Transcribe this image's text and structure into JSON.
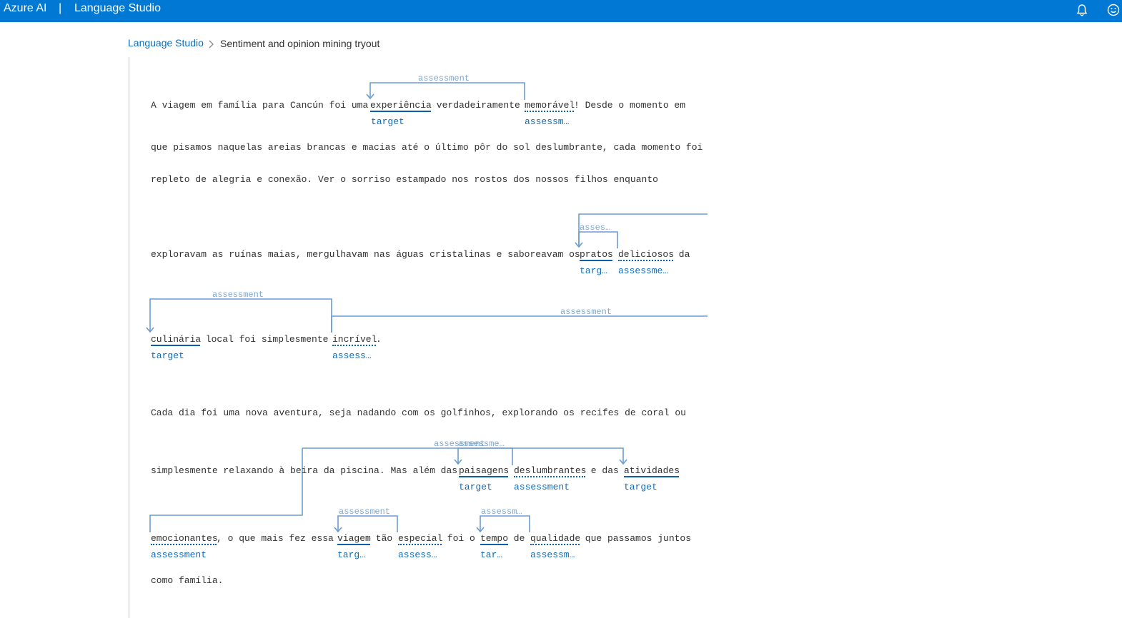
{
  "header": {
    "brand": "Azure AI",
    "separator": "|",
    "product": "Language Studio"
  },
  "breadcrumb": {
    "home": "Language Studio",
    "current": "Sentiment and opinion mining tryout"
  },
  "labels": {
    "target": "target",
    "assessment": "assessment",
    "targ_trunc": "targ…",
    "tar_trunc": "tar…",
    "assess_trunc": "assess…",
    "assessm_trunc": "assessm…",
    "assessme_trunc": "assessme…",
    "asses_trunc": "asses…",
    "assessme_trunc_over": "assessme…",
    "assessm_over": "assessm…"
  },
  "document": {
    "line1": {
      "a": "A viagem em família para Cancún foi uma ",
      "w1": "experiência",
      "b": " verdadeiramente ",
      "w2": "memorável",
      "c": "! Desde o momento em"
    },
    "line2": "que pisamos naquelas areias brancas e macias até o último pôr do sol deslumbrante, cada momento foi",
    "line3": "repleto de alegria e conexão. Ver o sorriso estampado nos rostos dos nossos filhos enquanto",
    "line4": {
      "a": "exploravam as ruínas maias, mergulhavam nas águas cristalinas e saboreavam os ",
      "w1": "pratos",
      "b": " ",
      "w2": "deliciosos",
      "c": " da"
    },
    "line5": {
      "w1": "culinária",
      "a": " local foi simplesmente ",
      "w2": "incrível",
      "b": "."
    },
    "line6": "Cada dia foi uma nova aventura, seja nadando com os golfinhos, explorando os recifes de coral ou",
    "line7": {
      "a": "simplesmente relaxando à beira da piscina. Mas além das ",
      "w1": "paisagens",
      "b": " ",
      "w2": "deslumbrantes",
      "c": " e das ",
      "w3": "atividades"
    },
    "line8": {
      "w1": "emocionantes",
      "a": ", o que mais fez essa ",
      "w2": "viagem",
      "b": " tão ",
      "w3": "especial",
      "c": " foi o ",
      "w4": "tempo",
      "d": " de ",
      "w5": "qualidade",
      "e": " que passamos juntos"
    },
    "line9": "como família."
  },
  "colors": {
    "header_bg": "#0078d4",
    "link": "#0f6cbd",
    "arc": "#6b9ccf",
    "arc_label": "#7fa8cc"
  }
}
